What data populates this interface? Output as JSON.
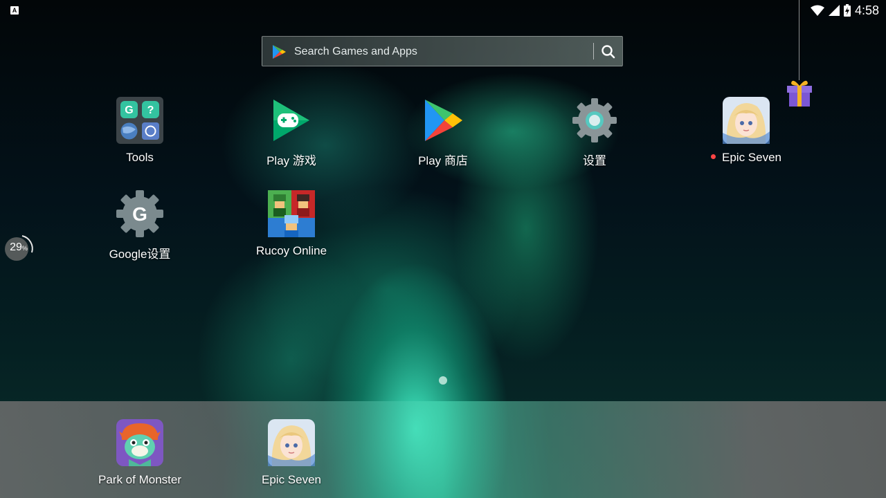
{
  "status_bar": {
    "notification_icon": "A",
    "icons": [
      "wifi-icon",
      "signal-icon",
      "battery-charging-icon"
    ],
    "time": "4:58"
  },
  "search": {
    "placeholder": "Search Games and Apps",
    "logo": "play-store-logo-icon",
    "button_icon": "search-icon"
  },
  "home_apps": [
    {
      "label": "Tools",
      "icon": "tools-folder-icon"
    },
    {
      "label": "Play 游戏",
      "icon": "play-games-icon"
    },
    {
      "label": "Play 商店",
      "icon": "play-store-icon"
    },
    {
      "label": "设置",
      "icon": "settings-gear-icon"
    },
    {
      "label": "Epic Seven",
      "icon": "epic-seven-icon",
      "new_badge": true
    },
    {
      "label": "Google设置",
      "icon": "google-settings-icon"
    },
    {
      "label": "Rucoy Online",
      "icon": "rucoy-online-icon"
    }
  ],
  "dock_apps": [
    {
      "label": "Park of Monster",
      "icon": "park-of-monster-icon"
    },
    {
      "label": "Epic Seven",
      "icon": "epic-seven-icon"
    }
  ],
  "progress_widget": {
    "value": "29",
    "unit": "%"
  },
  "gift": {
    "icon": "gift-icon"
  },
  "colors": {
    "badge_red": "#ff4545",
    "text": "#ffffff"
  }
}
